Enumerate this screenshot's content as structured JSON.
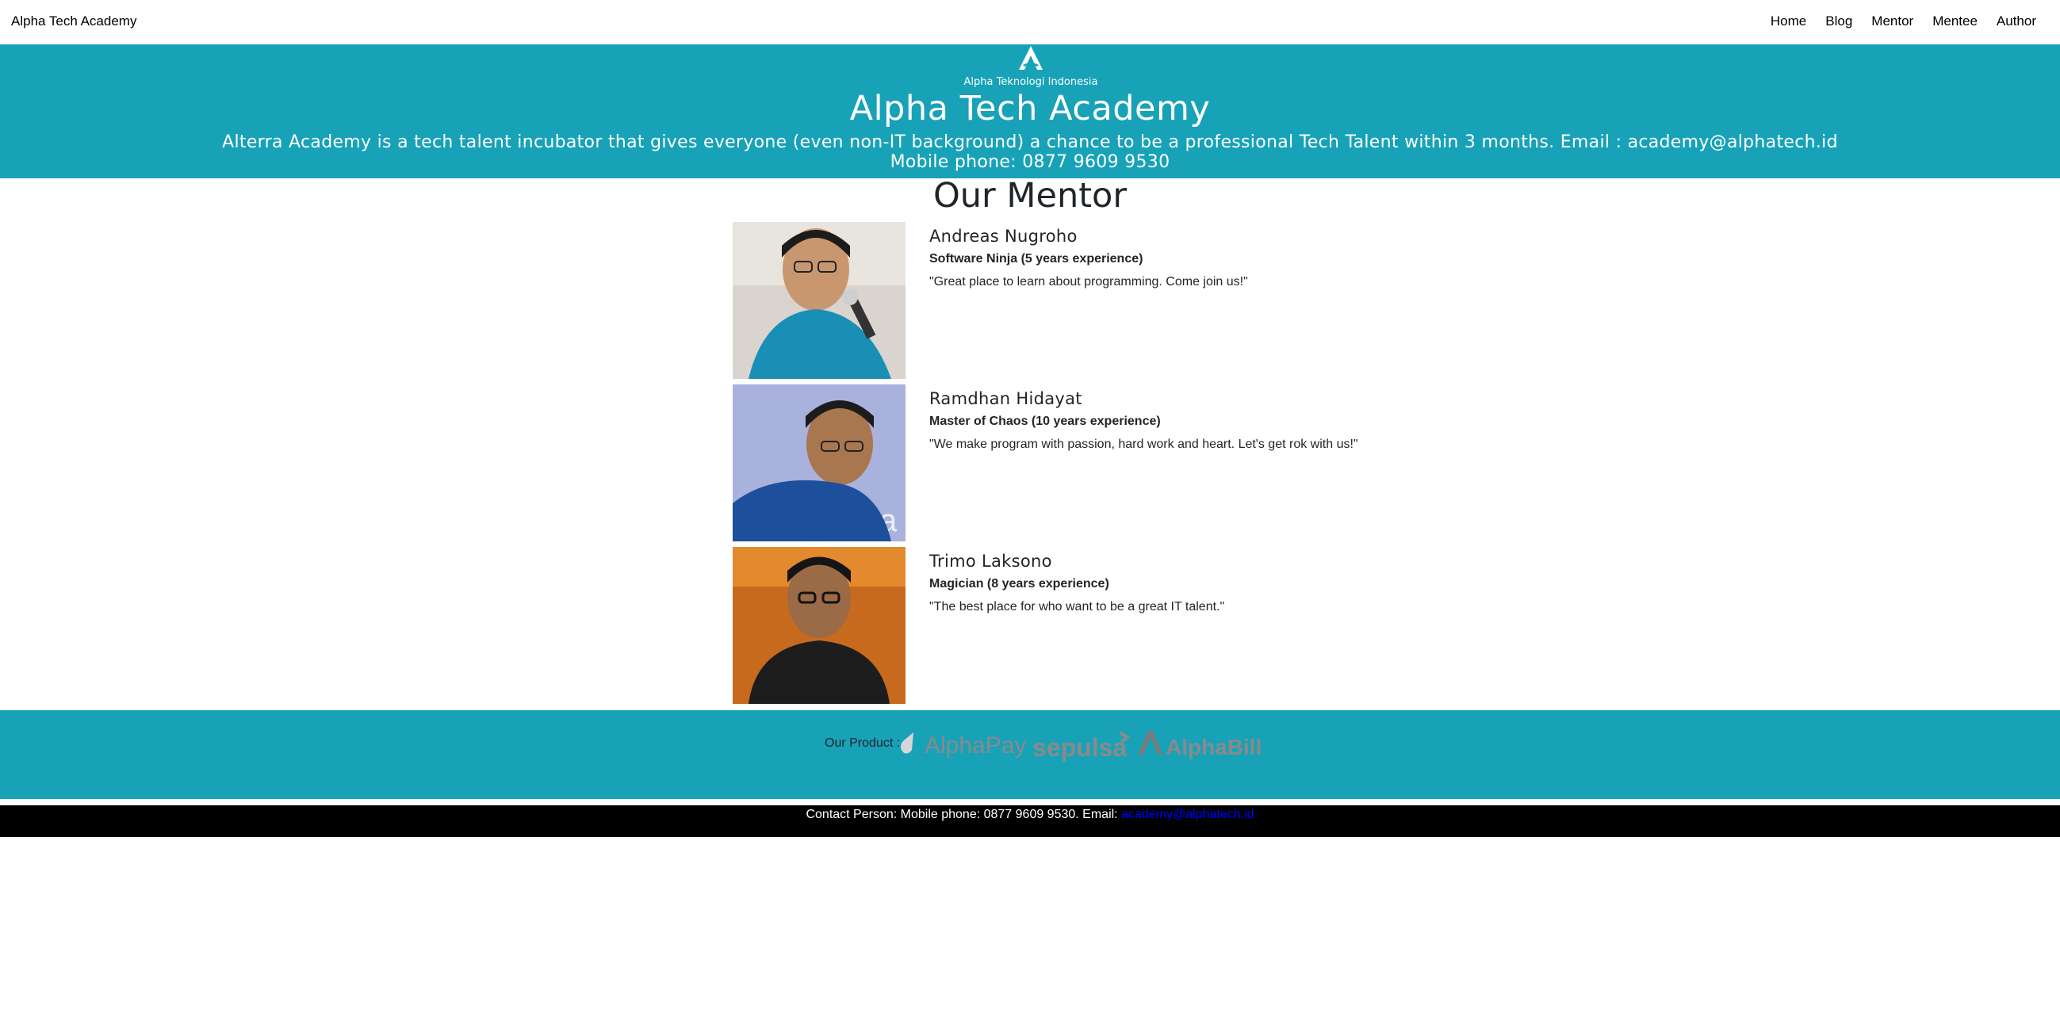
{
  "navbar": {
    "brand": "Alpha Tech Academy",
    "links": [
      "Home",
      "Blog",
      "Mentor",
      "Mentee",
      "Author"
    ]
  },
  "hero": {
    "logo_caption": "Alpha Teknologi Indonesia",
    "title": "Alpha Tech Academy",
    "description_line1": "Alterra Academy is a tech talent incubator that gives everyone (even non-IT background) a chance to be a professional Tech Talent within 3 months. Email : academy@alphatech.id",
    "description_line2": "Mobile phone: 0877 9609 9530"
  },
  "mentors_section": {
    "title": "Our Mentor",
    "mentors": [
      {
        "name": "Andreas Nugroho",
        "role": "Software Ninja (5 years experience)",
        "quote": "\"Great place to learn about programming. Come join us!\""
      },
      {
        "name": "Ramdhan Hidayat",
        "role": "Master of Chaos (10 years experience)",
        "quote": "\"We make program with passion, hard work and heart. Let's get rok with us!\""
      },
      {
        "name": "Trimo Laksono",
        "role": "Magician (8 years experience)",
        "quote": "\"The best place for who want to be a great IT talent.\""
      }
    ]
  },
  "products": {
    "label": "Our Product :",
    "logos": [
      "AlphaPay",
      "sepulsa",
      "AlphaBill"
    ]
  },
  "contact": {
    "text": "Contact Person: Mobile phone: 0877 9609 9530. Email: ",
    "email": "academy@alphatech.id"
  },
  "colors": {
    "accent": "#17a2b8",
    "footer_bg": "#000000",
    "link": "#0000ff"
  }
}
